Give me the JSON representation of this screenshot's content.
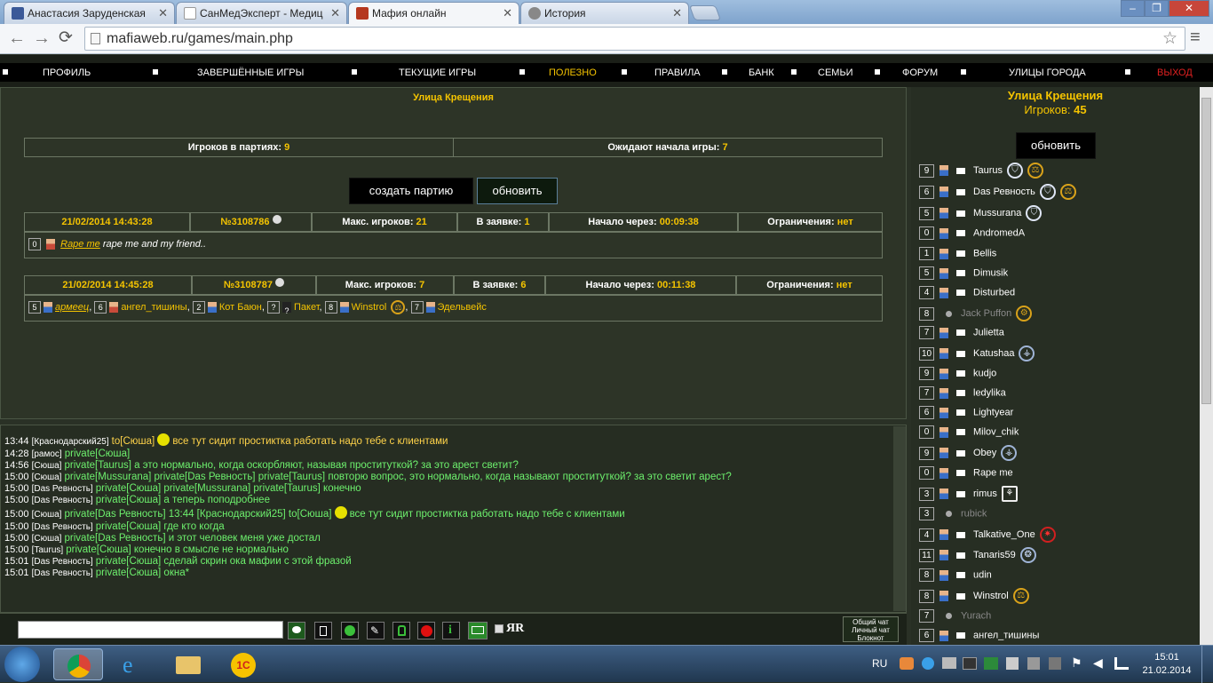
{
  "browser": {
    "tabs": [
      {
        "title": "Анастасия Заруденская",
        "favicon_color": "#3b5998"
      },
      {
        "title": "СанМедЭксперт - Медиц",
        "favicon_color": "#ffffff"
      },
      {
        "title": "Мафия онлайн",
        "favicon_color": "#b5381f"
      },
      {
        "title": "История",
        "favicon_color": "#888888"
      }
    ],
    "url": "mafiaweb.ru/games/main.php"
  },
  "menu": [
    "ПРОФИЛЬ",
    "ЗАВЕРШЁННЫЕ ИГРЫ",
    "ТЕКУЩИЕ ИГРЫ",
    "ПОЛЕЗНО",
    "ПРАВИЛА",
    "БАНК",
    "СЕМЬИ",
    "ФОРУМ",
    "УЛИЦЫ ГОРОДА",
    "ВЫХОД"
  ],
  "main": {
    "title": "Улица Крещения",
    "players_in_games_label": "Игроков в партиях:",
    "players_in_games": "9",
    "waiting_label": "Ожидают начала игры:",
    "waiting": "7",
    "create_button": "создать партию",
    "refresh_button": "обновить",
    "games": [
      {
        "date": "21/02/2014 14:43:28",
        "number": "№3108786",
        "max_label": "Макс. игроков:",
        "max": "21",
        "req_label": "В заявке:",
        "req": "1",
        "start_label": "Начало через:",
        "start": "00:09:38",
        "limit_label": "Ограничения:",
        "limit": "нет",
        "players": [
          {
            "num": "0",
            "name": "Rape me",
            "comment": "rape me and my friend.."
          }
        ]
      },
      {
        "date": "21/02/2014 14:45:28",
        "number": "№3108787",
        "max_label": "Макс. игроков:",
        "max": "7",
        "req_label": "В заявке:",
        "req": "6",
        "start_label": "Начало через:",
        "start": "00:11:38",
        "limit_label": "Ограничения:",
        "limit": "нет",
        "players": [
          {
            "num": "5",
            "name": "армеец"
          },
          {
            "num": "6",
            "name": "ангел_тишины"
          },
          {
            "num": "2",
            "name": "Кот Баюн"
          },
          {
            "num": "?",
            "name": "Пакет"
          },
          {
            "num": "8",
            "name": "Winstrol"
          },
          {
            "num": "7",
            "name": "Эдельвейс"
          }
        ]
      }
    ]
  },
  "chat": [
    {
      "time": "13:44",
      "sender": "[Краснодарский25]",
      "text": "to[Сюша]",
      "text2": "все тут сидит простиктка работать надо тебе с клиентами",
      "yellow": true
    },
    {
      "time": "14:28",
      "sender": "[рамос]",
      "text": "private[Сюша]"
    },
    {
      "time": "14:56",
      "sender": "[Сюша]",
      "text": "private[Taurus] а это нормально, когда оскорбляют, называя проституткой? за это арест светит?"
    },
    {
      "time": "15:00",
      "sender": "[Сюша]",
      "text": "private[Mussurana] private[Das Ревность] private[Taurus] повторю вопрос, это нормально, когда называют проституткой? за это светит арест?"
    },
    {
      "time": "15:00",
      "sender": "[Das Ревность]",
      "text": "private[Сюша] private[Mussurana] private[Taurus] конечно"
    },
    {
      "time": "15:00",
      "sender": "[Das Ревность]",
      "text": "private[Сюша] а теперь поподробнее"
    },
    {
      "time": "15:00",
      "sender": "[Сюша]",
      "text": "private[Das Ревность] 13:44 [Краснодарский25] to[Сюша]",
      "text2": "все тут сидит простиктка работать надо тебе с клиентами",
      "ball": true
    },
    {
      "time": "15:00",
      "sender": "[Das Ревность]",
      "text": "private[Сюша] где кто когда"
    },
    {
      "time": "15:00",
      "sender": "[Сюша]",
      "text": "private[Das Ревность] и этот человек меня уже достал"
    },
    {
      "time": "15:00",
      "sender": "[Taurus]",
      "text": "private[Сюша] конечно в смысле не нормально"
    },
    {
      "time": "15:01",
      "sender": "[Das Ревность]",
      "text": "private[Сюша] сделай скрин ока мафии с этой фразой"
    },
    {
      "time": "15:01",
      "sender": "[Das Ревность]",
      "text": "private[Сюша] окна*"
    }
  ],
  "chatbar": {
    "chat_links": [
      "Общий чат",
      "Личный чат",
      "Блокнот"
    ],
    "jr": "ЯR"
  },
  "right": {
    "title": "Улица Крещения",
    "count_label": "Игроков:",
    "count": "45",
    "refresh_button": "обновить",
    "players": [
      {
        "num": "9",
        "name": "Taurus",
        "badges": [
          "shield",
          "scales"
        ]
      },
      {
        "num": "6",
        "name": "Das Ревность",
        "badges": [
          "shield",
          "scales"
        ]
      },
      {
        "num": "5",
        "name": "Mussurana",
        "badges": [
          "shield"
        ]
      },
      {
        "num": "0",
        "name": "AndromedA",
        "badges": []
      },
      {
        "num": "1",
        "name": "Bellis",
        "badges": []
      },
      {
        "num": "5",
        "name": "Dimusik",
        "badges": []
      },
      {
        "num": "4",
        "name": "Disturbed",
        "badges": []
      },
      {
        "num": "8",
        "name": "Jack Puffon",
        "badges": [
          "gear"
        ],
        "offline": true
      },
      {
        "num": "7",
        "name": "Julietta",
        "badges": []
      },
      {
        "num": "10",
        "name": "Katushaa",
        "badges": [
          "wings"
        ]
      },
      {
        "num": "9",
        "name": "kudjo",
        "badges": []
      },
      {
        "num": "7",
        "name": "ledylika",
        "badges": []
      },
      {
        "num": "6",
        "name": "Lightyear",
        "badges": []
      },
      {
        "num": "0",
        "name": "Milov_chik",
        "badges": []
      },
      {
        "num": "9",
        "name": "Obey",
        "badges": [
          "wings"
        ]
      },
      {
        "num": "0",
        "name": "Rape me",
        "badges": []
      },
      {
        "num": "3",
        "name": "rimus",
        "badges": [
          "tree"
        ]
      },
      {
        "num": "3",
        "name": "rubick",
        "badges": [],
        "offline": true
      },
      {
        "num": "4",
        "name": "Talkative_One",
        "badges": [
          "star"
        ]
      },
      {
        "num": "11",
        "name": "Tanaris59",
        "badges": [
          "eagle"
        ]
      },
      {
        "num": "8",
        "name": "udin",
        "badges": []
      },
      {
        "num": "8",
        "name": "Winstrol",
        "badges": [
          "scales"
        ]
      },
      {
        "num": "7",
        "name": "Yurach",
        "badges": [],
        "offline": true
      },
      {
        "num": "6",
        "name": "ангел_тишины",
        "badges": []
      }
    ]
  },
  "taskbar": {
    "lang": "RU",
    "time": "15:01",
    "date": "21.02.2014"
  }
}
